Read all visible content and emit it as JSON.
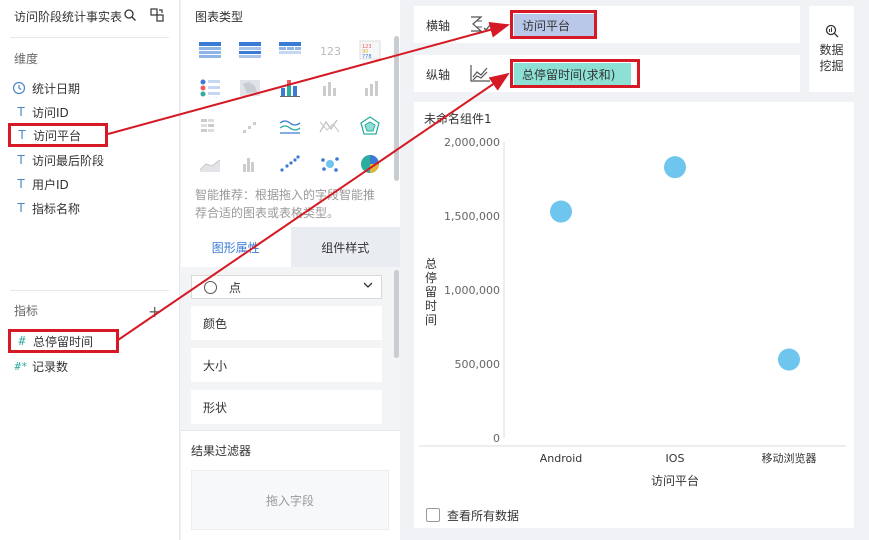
{
  "left": {
    "title": "访问阶段统计事实表",
    "dimensions_label": "维度",
    "dimensions": [
      {
        "icon": "clock-icon",
        "label": "统计日期"
      },
      {
        "icon": "text-type-icon",
        "label": "访问ID"
      },
      {
        "icon": "text-type-icon",
        "label": "访问平台"
      },
      {
        "icon": "text-type-icon",
        "label": "访问最后阶段"
      },
      {
        "icon": "text-type-icon",
        "label": "用户ID"
      },
      {
        "icon": "text-type-icon",
        "label": "指标名称"
      }
    ],
    "type_glyph": "T",
    "metrics_label": "指标",
    "add_glyph": "+",
    "metrics": [
      {
        "icon": "number-type-icon",
        "glyph": "#",
        "label": "总停留时间"
      },
      {
        "icon": "record-count-icon",
        "glyph": "#*",
        "label": "记录数"
      }
    ]
  },
  "middle": {
    "chart_types_label": "图表类型",
    "smart_hint": "智能推荐：根据拖入的字段智能推荐合适的图表或表格类型。",
    "tabs": [
      "图形属性",
      "组件样式"
    ],
    "shape_select": "点",
    "props": [
      "颜色",
      "大小",
      "形状"
    ],
    "filter_title": "结果过滤器",
    "drop_hint": "拖入字段"
  },
  "axes": {
    "x_label": "横轴",
    "x_field": "访问平台",
    "y_label": "纵轴",
    "y_field": "总停留时间(求和)"
  },
  "mining": {
    "line1": "数据",
    "line2": "挖掘"
  },
  "chart_card": {
    "title": "未命名组件1",
    "show_all_label": "查看所有数据"
  },
  "chart_data": {
    "type": "scatter",
    "title": "",
    "xlabel": "访问平台",
    "ylabel": "总停留时间",
    "categories": [
      "Android",
      "IOS",
      "移动浏览器"
    ],
    "values": [
      1530000,
      1830000,
      530000
    ],
    "ylim": [
      0,
      2000000
    ],
    "yticks": [
      0,
      500000,
      1000000,
      1500000,
      2000000
    ],
    "ytick_labels": [
      "0",
      "500,000",
      "1,000,000",
      "1,500,000",
      "2,000,000"
    ],
    "color": "#6ec5ee",
    "grid": false
  },
  "colors": {
    "highlight": "#d51a25",
    "accent": "#3a7bd5",
    "dimension_icon": "#4d86c7",
    "metric_icon": "#2dad9f",
    "x_pill": "#b9c7e8",
    "y_pill": "#8de0d4"
  }
}
